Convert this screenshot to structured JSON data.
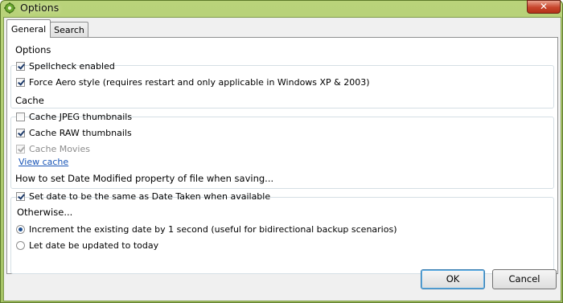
{
  "window": {
    "title": "Options",
    "close_glyph": "✕",
    "icon": "gear-icon"
  },
  "tabs": [
    {
      "label": "General"
    },
    {
      "label": "Search"
    }
  ],
  "options": {
    "title": "Options",
    "items": [
      {
        "label": "Spellcheck enabled",
        "checked": true
      },
      {
        "label": "Force Aero style (requires restart and only applicable in Windows XP & 2003)",
        "checked": true
      }
    ]
  },
  "cache": {
    "title": "Cache",
    "items": [
      {
        "label": "Cache JPEG thumbnails",
        "checked": false
      },
      {
        "label": "Cache RAW thumbnails",
        "checked": true
      },
      {
        "label": "Cache Movies",
        "checked": true,
        "disabled": true
      }
    ],
    "link": "View cache"
  },
  "date": {
    "title": "How to set Date Modified property of file when saving...",
    "checkbox": {
      "label": "Set date to be the same as Date Taken when available",
      "checked": true
    },
    "otherwise_label": "Otherwise...",
    "radios": [
      {
        "label": "Increment the existing date by 1 second (useful for bidirectional backup scenarios)",
        "selected": true
      },
      {
        "label": "Let date be updated to today",
        "selected": false
      }
    ]
  },
  "buttons": {
    "ok": "OK",
    "cancel": "Cancel"
  },
  "colors": {
    "titlebar": "#b9d37a",
    "close": "#c7452c",
    "link": "#1a56b8",
    "panel": "#ffffff",
    "dialog": "#f0f0f0"
  }
}
